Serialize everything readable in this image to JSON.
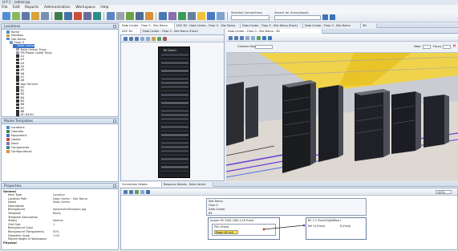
{
  "window": {
    "title": "H P C - (admin)@"
  },
  "menu": [
    "File",
    "Edit",
    "Reports",
    "Administration",
    "Workspace",
    "Help"
  ],
  "toolbar": {
    "selected_connections_label": "Selected Connections",
    "search_label": "Search for (Conn/Asset)"
  },
  "locations_panel": {
    "title": "Locations",
    "tree": [
      "Home",
      "Sandbox",
      "Site Demo",
      "Floor 0",
      "Data Center",
      "Data Center Trays",
      "PM Power Cable Trays",
      "A1",
      "A2",
      "A3",
      "A4",
      "A5",
      "A6",
      "A7",
      "A8",
      "App Servers",
      "B1",
      "B2",
      "B3",
      "B4",
      "B5",
      "B6",
      "B7",
      "B8",
      "DC-IM-B1"
    ]
  },
  "model_templates_panel": {
    "title": "Model Templates",
    "items": [
      "Locations",
      "Cabinets",
      "Equipment",
      "Cables",
      "Stock",
      "Components",
      "Configurations"
    ]
  },
  "properties_panel": {
    "title": "Properties",
    "sections": [
      "General",
      "Physical"
    ],
    "rows": [
      {
        "key": "Item Type",
        "value": "Location"
      },
      {
        "key": "Location Path",
        "value": "Data Center - Site Demo"
      },
      {
        "key": "Name",
        "value": "Data Center"
      },
      {
        "key": "Description",
        "value": ""
      },
      {
        "key": "Background",
        "value": "datacenterfloorplan.jpg"
      },
      {
        "key": "Template",
        "value": "Room"
      },
      {
        "key": "Template Description",
        "value": ""
      },
      {
        "key": "Status",
        "value": "Normal"
      },
      {
        "key": "Grid Size",
        "value": "1"
      },
      {
        "key": "Background Color",
        "value": ""
      },
      {
        "key": "Background Transparency",
        "value": "50%"
      },
      {
        "key": "Diameter Scale",
        "value": "1.00"
      },
      {
        "key": "Parent Height in Workspace",
        "value": ""
      }
    ]
  },
  "main_tabs": [
    "Data Center - Floor 0 - Site Demo",
    "DCE 3D - Data Center - Floor 0 - Site Demo",
    "Data Center - Floor 0 - Site Demo (Front)",
    "Data Center - Floor 0 - Site Demo",
    "3D"
  ],
  "inner_tabs_left": [
    "DCE 3D",
    "Data Center - Floor 0 - Site Demo (Front)"
  ],
  "inner_tabs_right": [
    "Data Center - Floor 0 - Site Demo - 3D"
  ],
  "view3d_toolbar": {
    "camera_step_label": "Camera Step",
    "near_label": "Near",
    "focus_label": "Focus"
  },
  "rack_front_label": "B5 (Front)",
  "bottom_tabs": [
    "Connection Details",
    "Resource Details - Data Center"
  ],
  "connection_details": {
    "zoom_value": "100%",
    "path": [
      "Site Demo",
      "Floor 0",
      "Data Center",
      "B5"
    ],
    "left_device": "Juniper EX 2200 (48U 4-10 Front)",
    "left_sub": "PSU (Front)",
    "left_port": "Power 18 (ref)",
    "right_device": "B5 1.3 (Front,Right/Rear)",
    "right_port": "Ref 14 (Front)",
    "right_port2": "B (Front)"
  }
}
